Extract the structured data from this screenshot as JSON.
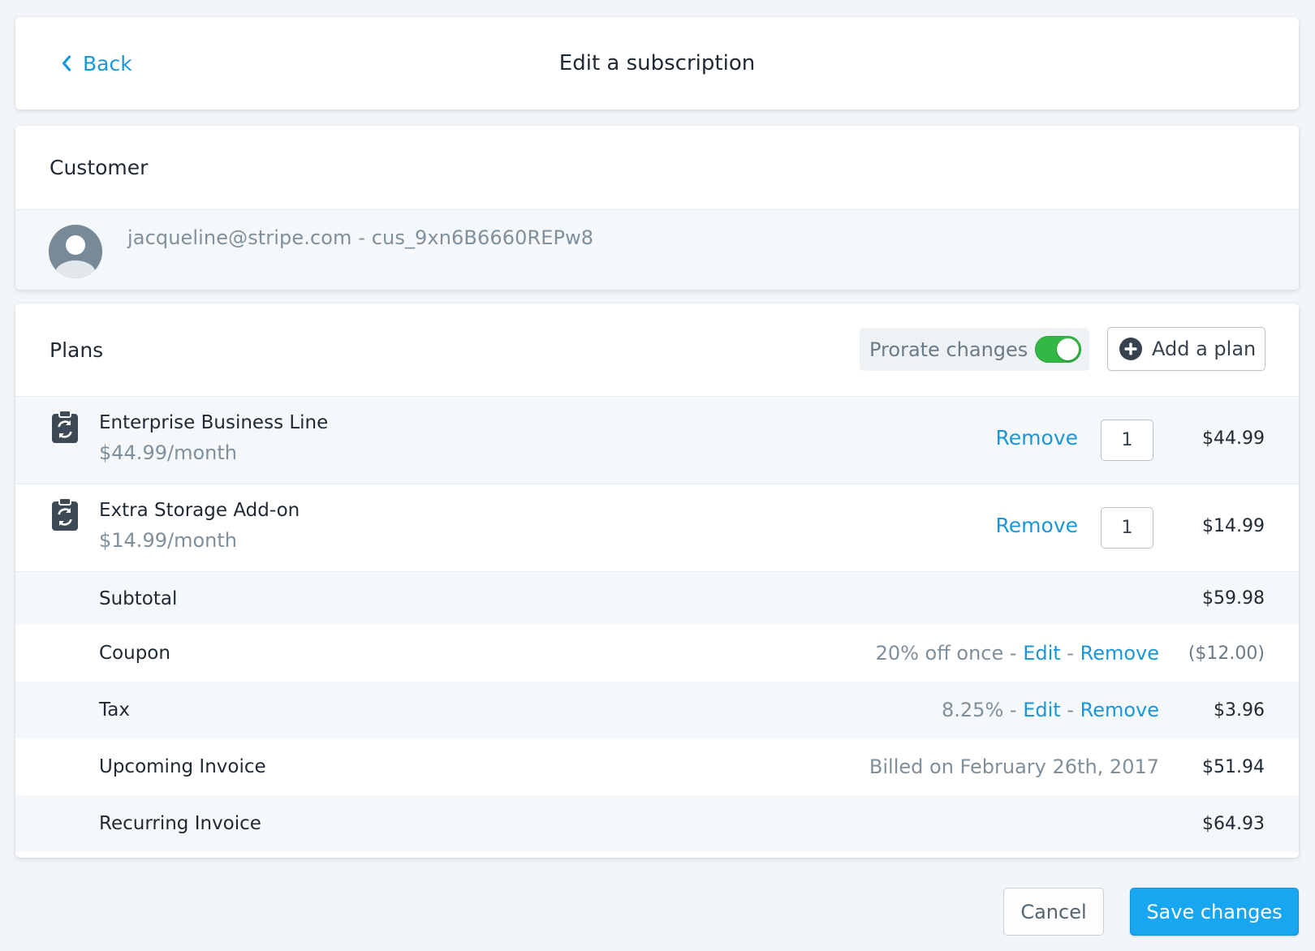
{
  "header": {
    "back_label": "Back",
    "title": "Edit a subscription"
  },
  "customer": {
    "section_title": "Customer",
    "identity": "jacqueline@stripe.com - cus_9xn6B6660REPw8",
    "avatar_icon": "user-avatar-icon"
  },
  "plans": {
    "section_title": "Plans",
    "prorate_label": "Prorate changes",
    "prorate_enabled": true,
    "add_plan_label": "Add a plan",
    "items": [
      {
        "name": "Enterprise Business Line",
        "price": "$44.99/month",
        "remove_label": "Remove",
        "quantity": "1",
        "amount": "$44.99",
        "icon": "recurring-clipboard-icon"
      },
      {
        "name": "Extra Storage Add-on",
        "price": "$14.99/month",
        "remove_label": "Remove",
        "quantity": "1",
        "amount": "$14.99",
        "icon": "recurring-clipboard-icon"
      }
    ]
  },
  "summary": {
    "subtotal": {
      "label": "Subtotal",
      "amount": "$59.98"
    },
    "coupon": {
      "label": "Coupon",
      "detail": "20% off once",
      "sep": " - ",
      "edit_label": "Edit",
      "remove_label": "Remove",
      "amount": "($12.00)"
    },
    "tax": {
      "label": "Tax",
      "detail": "8.25%",
      "sep": " - ",
      "edit_label": "Edit",
      "remove_label": "Remove",
      "amount": "$3.96"
    },
    "upcoming": {
      "label": "Upcoming Invoice",
      "detail": "Billed on February 26th, 2017",
      "amount": "$51.94"
    },
    "recurring": {
      "label": "Recurring Invoice",
      "amount": "$64.93"
    }
  },
  "footer": {
    "cancel_label": "Cancel",
    "save_label": "Save changes"
  },
  "colors": {
    "accent": "#1a97d8",
    "toggle_on": "#33b847",
    "save_button": "#19a6f0",
    "muted_text": "#7f8f9b"
  }
}
